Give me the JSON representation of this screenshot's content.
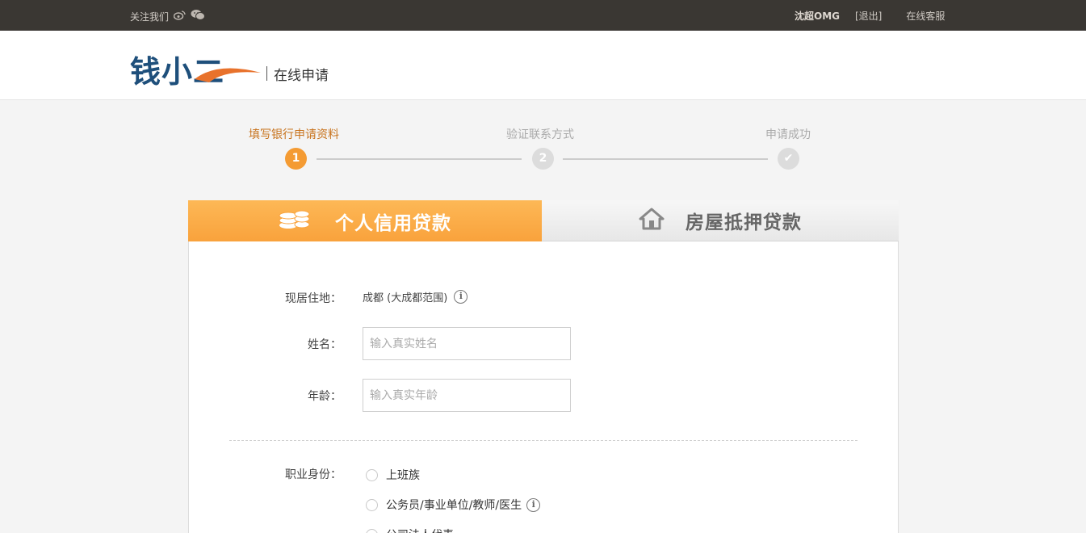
{
  "topbar": {
    "follow_label": "关注我们",
    "weibo_icon": "weibo-icon",
    "wechat_icon": "wechat-icon",
    "user_name": "沈超OMG",
    "logout_label": "[退出]",
    "service_label": "在线客服"
  },
  "header": {
    "logo_text": "钱小二",
    "subtitle": "在线申请"
  },
  "steps": [
    {
      "label": "填写银行申请资料",
      "number": "1",
      "state": "active"
    },
    {
      "label": "验证联系方式",
      "number": "2",
      "state": "pending"
    },
    {
      "label": "申请成功",
      "number": "✔",
      "state": "pending"
    }
  ],
  "tabs": {
    "personal": {
      "label": "个人信用贷款",
      "icon": "coins-icon"
    },
    "house": {
      "label": "房屋抵押贷款",
      "icon": "house-icon"
    }
  },
  "form": {
    "residence_label": "现居住地：",
    "residence_value": "成都 (大成都范围)",
    "name_label": "姓名：",
    "name_placeholder": "输入真实姓名",
    "age_label": "年龄：",
    "age_placeholder": "输入真实年龄",
    "occupation_label": "职业身份：",
    "occupation_options": [
      "上班族",
      "公务员/事业单位/教师/医生",
      "公司法人代表"
    ]
  },
  "colors": {
    "accent": "#f49b33",
    "topbar": "#3a3733",
    "logo_blue": "#1e4f7b"
  }
}
